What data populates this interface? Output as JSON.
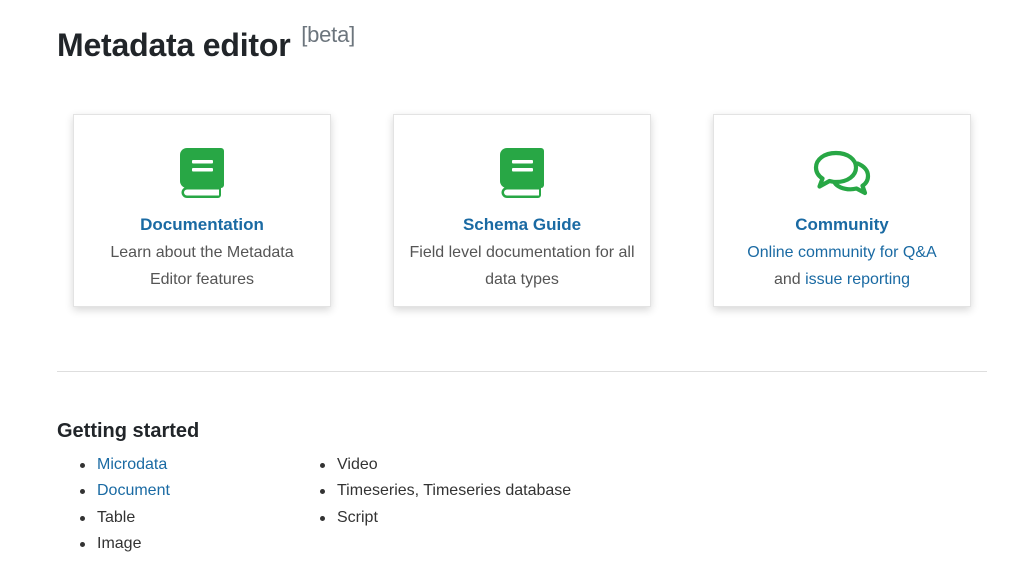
{
  "header": {
    "title": "Metadata editor",
    "tag": "[beta]"
  },
  "cards": [
    {
      "icon": "book-icon",
      "title": "Documentation",
      "description": "Learn about the Metadata Editor features"
    },
    {
      "icon": "book-icon",
      "title": "Schema Guide",
      "description": "Field level documentation for all data types"
    },
    {
      "icon": "chat-bubbles-icon",
      "title": "Community",
      "description_link1": "Online community for Q&A",
      "description_text": "and ",
      "description_link2": "issue reporting"
    }
  ],
  "getting_started": {
    "title": "Getting started",
    "column1": [
      {
        "label": "Microdata",
        "link": true
      },
      {
        "label": "Document",
        "link": true
      },
      {
        "label": "Table",
        "link": false
      },
      {
        "label": "Image",
        "link": false
      }
    ],
    "column2": [
      {
        "label": "Video",
        "link": false
      },
      {
        "label": "Timeseries, Timeseries database",
        "link": false
      },
      {
        "label": "Script",
        "link": false
      }
    ]
  },
  "colors": {
    "accent_link": "#1a6aa3",
    "icon_green": "#28a745"
  }
}
